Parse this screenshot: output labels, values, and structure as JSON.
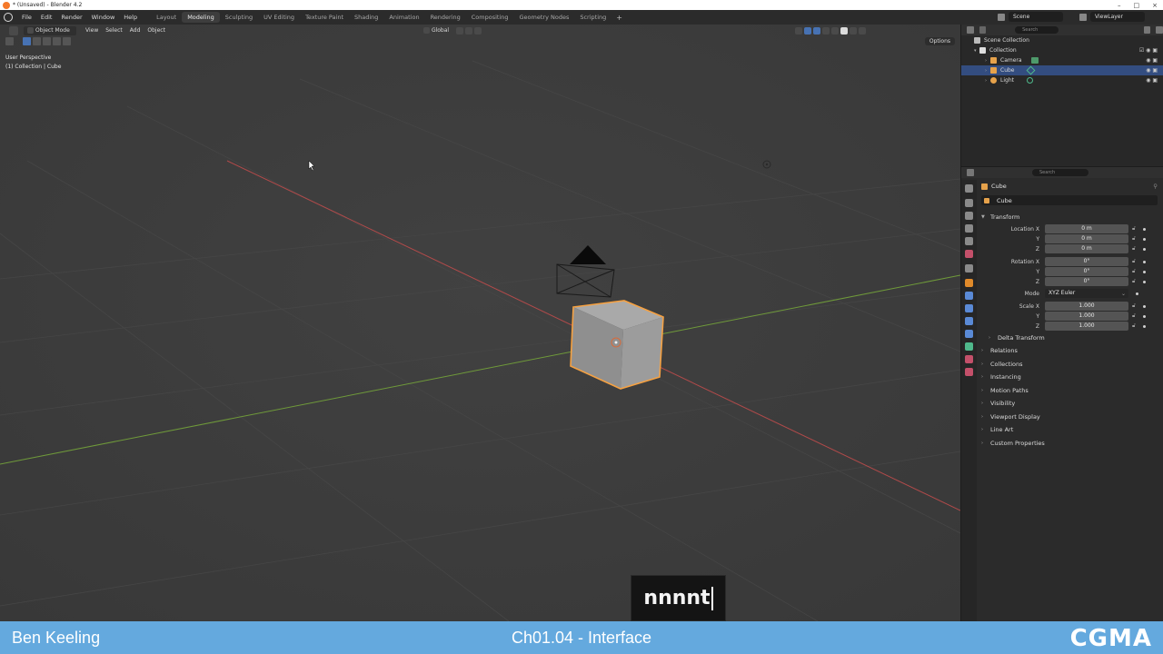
{
  "window": {
    "title": "* (Unsaved) - Blender 4.2",
    "controls": [
      "–",
      "□",
      "×"
    ]
  },
  "menubar": {
    "menus": [
      "File",
      "Edit",
      "Render",
      "Window",
      "Help"
    ],
    "workspaces": [
      "Layout",
      "Modeling",
      "Sculpting",
      "UV Editing",
      "Texture Paint",
      "Shading",
      "Animation",
      "Rendering",
      "Compositing",
      "Geometry Nodes",
      "Scripting"
    ],
    "active_workspace": "Modeling",
    "add_symbol": "+",
    "scene": "Scene",
    "view_layer": "ViewLayer"
  },
  "viewport": {
    "mode": "Object Mode",
    "menus": [
      "View",
      "Select",
      "Add",
      "Object"
    ],
    "transform_orientation": "Global",
    "options_label": "Options",
    "perspective_label": "User Perspective",
    "context_label": "(1) Collection | Cube"
  },
  "outliner": {
    "search_placeholder": "Search",
    "root": "Scene Collection",
    "collection": "Collection",
    "items": [
      {
        "label": "Camera",
        "color": "#e6a24b",
        "selected": false
      },
      {
        "label": "Cube",
        "color": "#e6a24b",
        "selected": true
      },
      {
        "label": "Light",
        "color": "#e6a24b",
        "selected": false
      }
    ]
  },
  "properties": {
    "search_placeholder": "Search",
    "object_title": "Cube",
    "object_name": "Cube",
    "transform_label": "Transform",
    "location": {
      "label": "Location X",
      "x": "0 m",
      "y": "0 m",
      "z": "0 m"
    },
    "rotation": {
      "label": "Rotation X",
      "x": "0°",
      "y": "0°",
      "z": "0°"
    },
    "mode": {
      "label": "Mode",
      "value": "XYZ Euler"
    },
    "scale": {
      "label": "Scale X",
      "x": "1.000",
      "y": "1.000",
      "z": "1.000"
    },
    "axis_y": "Y",
    "axis_z": "Z",
    "delta_transform": "Delta Transform",
    "sections": [
      "Relations",
      "Collections",
      "Instancing",
      "Motion Paths",
      "Visibility",
      "Viewport Display",
      "Line Art",
      "Custom Properties"
    ]
  },
  "typed_overlay": {
    "text": "nnnnt"
  },
  "footer": {
    "author": "Ben Keeling",
    "chapter": "Ch01.04 - Interface",
    "logo": "CGMA"
  },
  "colors": {
    "viewport_bg": "#3d3d3d",
    "selection_orange": "#f5a142",
    "x_axis": "#b14a4a",
    "y_axis": "#6f9a3a",
    "footer_blue": "#64a9de",
    "outliner_selected": "#334d80"
  }
}
